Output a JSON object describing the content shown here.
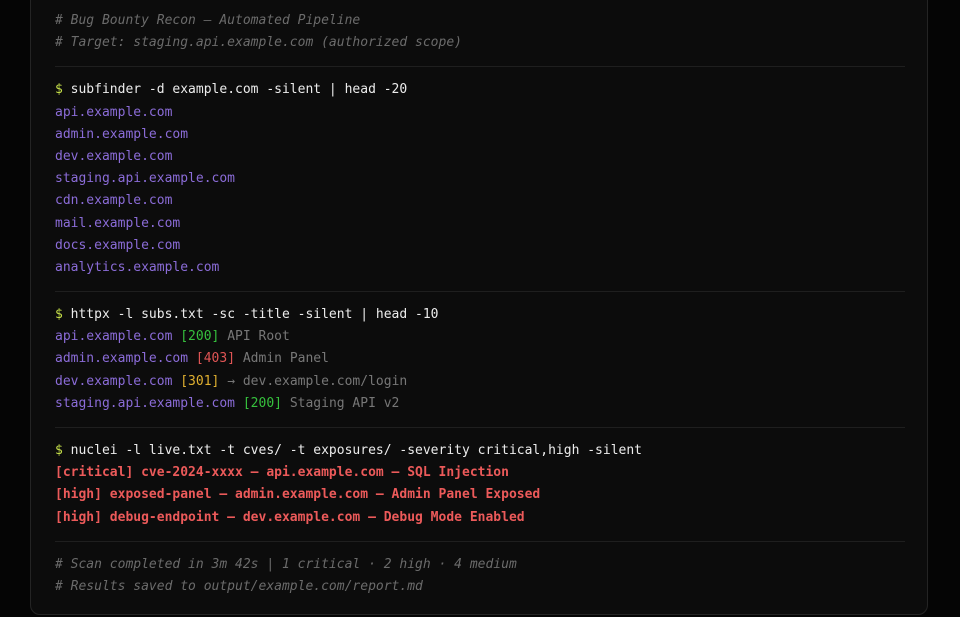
{
  "header_comments": [
    "# Bug Bounty Recon — Automated Pipeline",
    "# Target: staging.api.example.com (authorized scope)"
  ],
  "prompt_symbol": "$",
  "subfinder": {
    "command": "subfinder -d example.com -silent | head -20",
    "results": [
      "api.example.com",
      "admin.example.com",
      "dev.example.com",
      "staging.api.example.com",
      "cdn.example.com",
      "mail.example.com",
      "docs.example.com",
      "analytics.example.com"
    ]
  },
  "httpx": {
    "command": "httpx -l subs.txt -sc -title -silent | head -10",
    "results": [
      {
        "host": "api.example.com",
        "status": "[200]",
        "info": "API Root"
      },
      {
        "host": "admin.example.com",
        "status": "[403]",
        "info": "Admin Panel"
      },
      {
        "host": "dev.example.com",
        "status": "[301]",
        "info": "→ dev.example.com/login"
      },
      {
        "host": "staging.api.example.com",
        "status": "[200]",
        "info": "Staging API v2"
      }
    ]
  },
  "nuclei": {
    "command": "nuclei -l live.txt -t cves/ -t exposures/ -severity critical,high -silent",
    "findings": [
      "[critical] cve-2024-xxxx — api.example.com — SQL Injection",
      "[high] exposed-panel — admin.example.com — Admin Panel Exposed",
      "[high] debug-endpoint — dev.example.com — Debug Mode Enabled"
    ]
  },
  "footer_comments": [
    "# Scan completed in 3m 42s | 1 critical · 2 high · 4 medium",
    "# Results saved to output/example.com/report.md"
  ],
  "colors": {
    "background": "#0c0c0c",
    "prompt": "#c6e04a",
    "host": "#8b6cd8",
    "status_ok": "#36c13d",
    "status_forbidden": "#e05555",
    "status_redirect": "#e0b030",
    "finding": "#ec5a5a",
    "comment": "#6b6b6b"
  }
}
